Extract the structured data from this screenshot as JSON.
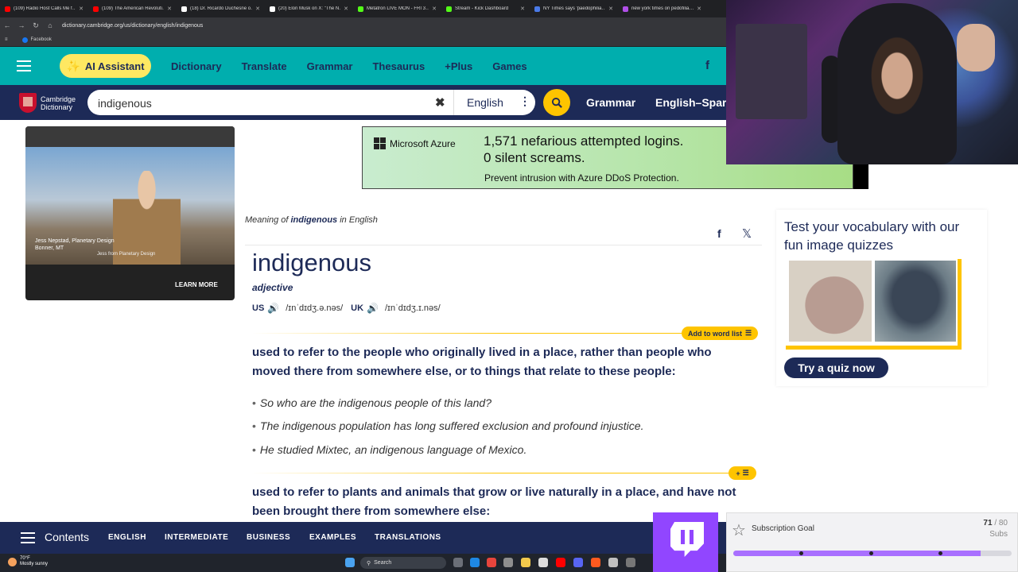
{
  "browser": {
    "tabs": [
      {
        "title": "(109) Radio Host Calls Me f…",
        "color": "#ff0000"
      },
      {
        "title": "(109) The American Revoluti…",
        "color": "#ff0000"
      },
      {
        "title": "(18) Dr. Ricardo Duchesne o…",
        "color": "#ffffff"
      },
      {
        "title": "(20) Elon Musk on X: \"The N…",
        "color": "#ffffff"
      },
      {
        "title": "Metatron LIVE MON - FRI 3…",
        "color": "#53fc18"
      },
      {
        "title": "Stream - Kick Dashboard",
        "color": "#53fc18"
      },
      {
        "title": "NY Times says 'paedophilia…",
        "color": "#4a7ae8"
      },
      {
        "title": "new york times on pedofilia…",
        "color": "#b04fe8"
      }
    ],
    "url": "dictionary.cambridge.org/us/dictionary/english/indigenous",
    "bookmark": "Facebook"
  },
  "topnav": {
    "ai_label": "AI Assistant",
    "links": [
      "Dictionary",
      "Translate",
      "Grammar",
      "Thesaurus",
      "+Plus",
      "Games"
    ],
    "fb": "f"
  },
  "searchbar": {
    "logo_line1": "Cambridge",
    "logo_line2": "Dictionary",
    "query": "indigenous",
    "clear": "✖",
    "language": "English",
    "dots": "⋮",
    "link_grammar": "Grammar",
    "link_translate": "English–Spar"
  },
  "video_ad": {
    "caption_line1": "Jess Nepstad, Planetary Design",
    "caption_line2": "Bonner, MT",
    "caption_sub": "Jess from Planetary Design",
    "learn_more": "LEARN MORE"
  },
  "azure": {
    "brand": "Microsoft Azure",
    "line1": "1,571 nefarious attempted logins.",
    "line2": "0 silent screams.",
    "sub": "Prevent intrusion with Azure DDoS Protection."
  },
  "entry": {
    "meaning_prefix": "Meaning of",
    "meaning_word": "indigenous",
    "meaning_suffix": "in English",
    "headword": "indigenous",
    "pos": "adjective",
    "us_label": "US",
    "us_ipa": "/ɪnˈdɪdʒ.ə.nəs/",
    "uk_label": "UK",
    "uk_ipa": "/ɪnˈdɪdʒ.ɪ.nəs/",
    "add_to_list": "Add to word list",
    "plus_label": "+",
    "sense1": "used to refer to the people who originally lived in a place, rather than people who moved there from somewhere else, or to things that relate to these people:",
    "examples": [
      "So who are the indigenous people of this land?",
      "The indigenous population has long suffered exclusion and profound injustice.",
      "He studied Mixtec, an indigenous language of Mexico."
    ],
    "sense2": "used to refer to plants and animals that grow or live naturally in a place, and have not been brought there from somewhere else:"
  },
  "quiz": {
    "title": "Test your vocabulary with our fun image quizzes",
    "button": "Try a quiz now"
  },
  "contents_bar": {
    "label": "Contents",
    "links": [
      "ENGLISH",
      "INTERMEDIATE",
      "BUSINESS",
      "EXAMPLES",
      "TRANSLATIONS"
    ]
  },
  "taskbar": {
    "temp": "70°F",
    "weather": "Mostly sunny",
    "search": "Search"
  },
  "sub_goal": {
    "title": "Subscription Goal",
    "current": 71,
    "goal": 80,
    "count_label": "71",
    "goal_label": "/ 80",
    "unit": "Subs"
  },
  "colors": {
    "navy": "#1d2a57",
    "teal": "#00aeae",
    "yellow": "#fec400",
    "twitch": "#9146ff"
  }
}
